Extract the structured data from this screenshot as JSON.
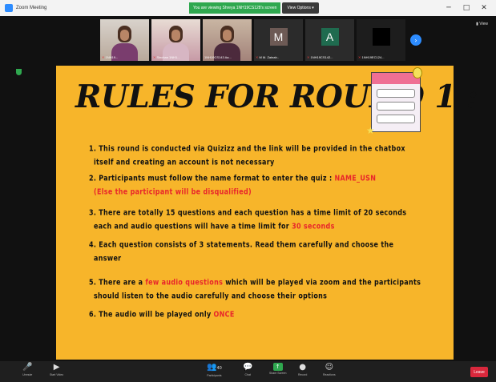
{
  "window": {
    "title": "Zoom Meeting",
    "share_banner": "You are viewing Shreya 1NH19CS128's screen",
    "view_options": "View Options ▾",
    "controls": [
      "─",
      "□",
      "✕"
    ]
  },
  "video_strip": {
    "participants": [
      {
        "name": "1NH19..."
      },
      {
        "name": "Sinchan 1NH1..."
      },
      {
        "name": "1NH19CS143 Aa..."
      },
      {
        "name": "M M. Zainab..",
        "initial": "M",
        "color": "#6d5a55"
      },
      {
        "name": "1NH19CS142...",
        "initial": "A",
        "color": "#1f6b4f"
      },
      {
        "name": "1NH19EC124..."
      }
    ],
    "view_label": "▮ View"
  },
  "slide": {
    "title": "RULES FOR ROUND 1 :",
    "rules": [
      {
        "lines": [
          [
            "1. This round is conducted via Quizizz and the link will be provided in the chatbox"
          ],
          [
            "itself and creating an account is not necessary"
          ]
        ]
      },
      {
        "lines": [
          [
            "2. Participants must follow the name format to enter the quiz : ",
            "NAME_USN"
          ],
          [
            "",
            "(Else the participant will be disqualified)"
          ]
        ]
      },
      {
        "lines": [
          [
            "3. There are totally 15 questions and each question has a time limit of 20  seconds"
          ],
          [
            "each and audio questions will have a time limit for ",
            "30 seconds"
          ]
        ]
      },
      {
        "lines": [
          [
            "4. Each question consists of  3 statements. Read them carefully and choose the"
          ],
          [
            "answer"
          ]
        ]
      },
      {
        "lines": [
          [
            "5. There are a ",
            "few audio questions",
            " which will be played via zoom and the participants"
          ],
          [
            "should listen to the audio carefully and choose their options"
          ]
        ]
      },
      {
        "lines": [
          [
            "6. The audio will be played only ",
            "ONCE"
          ]
        ]
      }
    ]
  },
  "toolbar": {
    "unmute": {
      "icon": "🎤",
      "label": "Unmute"
    },
    "start_video": {
      "icon": "▶",
      "label": "Start Video"
    },
    "participants": {
      "icon": "👥",
      "label": "Participants",
      "count": "40"
    },
    "chat": {
      "icon": "💬",
      "label": "Chat"
    },
    "share_screen": {
      "icon": "↑",
      "label": "Share Screen"
    },
    "record": {
      "icon": "●",
      "label": "Record"
    },
    "reactions": {
      "icon": "☺",
      "label": "Reactions"
    },
    "leave": "Leave"
  }
}
